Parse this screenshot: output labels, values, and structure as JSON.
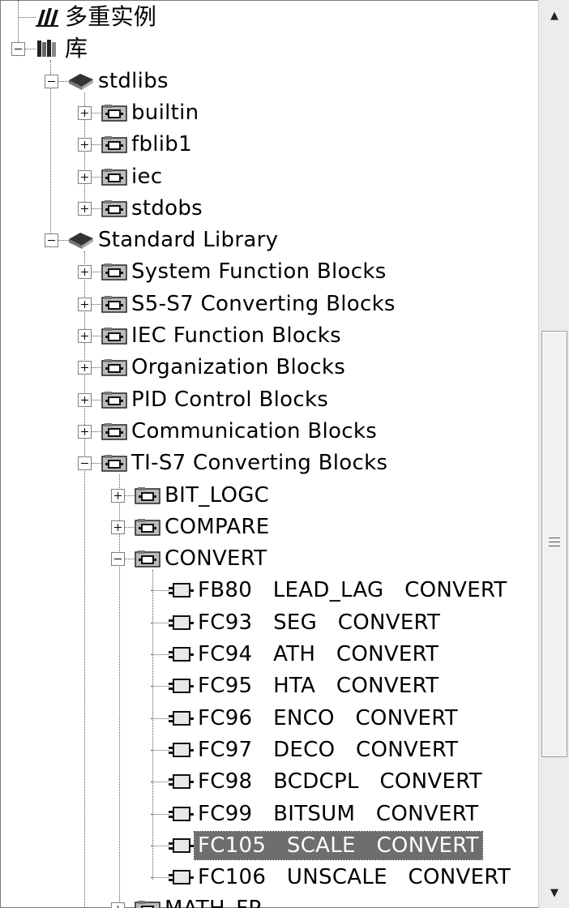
{
  "tree": {
    "nodes": [
      {
        "label": "多重实例",
        "icon": "multi-instance-icon",
        "cjk": true
      },
      {
        "label": "库",
        "icon": "library-icon",
        "cjk": true,
        "expanded": true
      },
      {
        "label": "stdlibs",
        "icon": "book-icon",
        "expanded": true
      },
      {
        "label": "builtin",
        "icon": "folder-icon",
        "expanded": false
      },
      {
        "label": "fblib1",
        "icon": "folder-icon",
        "expanded": false
      },
      {
        "label": "iec",
        "icon": "folder-icon",
        "expanded": false
      },
      {
        "label": "stdobs",
        "icon": "folder-icon",
        "expanded": false
      },
      {
        "label": "Standard Library",
        "icon": "book-icon",
        "expanded": true
      },
      {
        "label": "System Function Blocks",
        "icon": "folder-icon",
        "expanded": false
      },
      {
        "label": "S5-S7 Converting Blocks",
        "icon": "folder-icon",
        "expanded": false
      },
      {
        "label": "IEC Function Blocks",
        "icon": "folder-icon",
        "expanded": false
      },
      {
        "label": "Organization Blocks",
        "icon": "folder-icon",
        "expanded": false
      },
      {
        "label": "PID Control Blocks",
        "icon": "folder-icon",
        "expanded": false
      },
      {
        "label": "Communication Blocks",
        "icon": "folder-icon",
        "expanded": false
      },
      {
        "label": "TI-S7 Converting Blocks",
        "icon": "folder-icon",
        "expanded": true
      },
      {
        "label": "BIT_LOGC",
        "icon": "folder-icon",
        "expanded": false
      },
      {
        "label": "COMPARE",
        "icon": "folder-icon",
        "expanded": false
      },
      {
        "label": "CONVERT",
        "icon": "folder-icon",
        "expanded": true
      },
      {
        "label": "FB80   LEAD_LAG   CONVERT",
        "icon": "block-icon"
      },
      {
        "label": "FC93   SEG   CONVERT",
        "icon": "block-icon"
      },
      {
        "label": "FC94   ATH   CONVERT",
        "icon": "block-icon"
      },
      {
        "label": "FC95   HTA   CONVERT",
        "icon": "block-icon"
      },
      {
        "label": "FC96   ENCO   CONVERT",
        "icon": "block-icon"
      },
      {
        "label": "FC97   DECO   CONVERT",
        "icon": "block-icon"
      },
      {
        "label": "FC98   BCDCPL   CONVERT",
        "icon": "block-icon"
      },
      {
        "label": "FC99   BITSUM   CONVERT",
        "icon": "block-icon"
      },
      {
        "label": "FC105   SCALE   CONVERT",
        "icon": "block-icon",
        "selected": true
      },
      {
        "label": "FC106   UNSCALE   CONVERT",
        "icon": "block-icon"
      },
      {
        "label": "MATH_FP",
        "icon": "folder-icon",
        "expanded": false
      }
    ]
  },
  "scrollbar": {
    "up_icon": "scroll-up-icon",
    "down_icon": "scroll-down-icon",
    "grip_icon": "grip-icon"
  }
}
